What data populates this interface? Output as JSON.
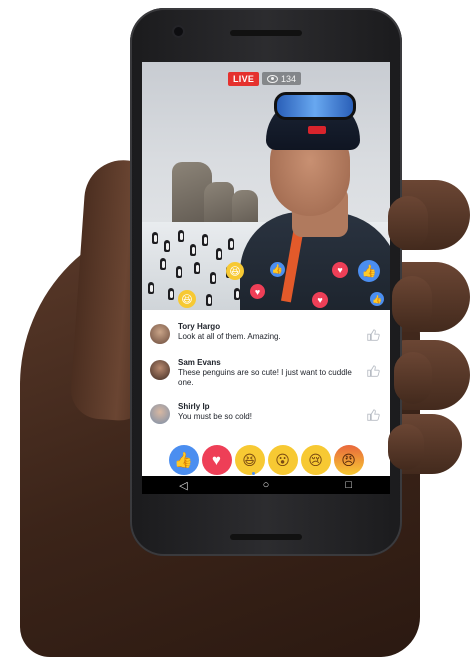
{
  "live": {
    "badge_label": "LIVE",
    "viewer_count": "134"
  },
  "comments": [
    {
      "name": "Tory Hargo",
      "text": "Look at all of them. Amazing."
    },
    {
      "name": "Sam Evans",
      "text": "These penguins are so cute! I just want to cuddle one."
    },
    {
      "name": "Shirly Ip",
      "text": "You must be so cold!"
    }
  ],
  "reactions": [
    {
      "id": "like",
      "icon": "thumbs-up-icon",
      "glyph": "👍"
    },
    {
      "id": "love",
      "icon": "heart-icon",
      "glyph": "♥"
    },
    {
      "id": "haha",
      "icon": "laughing-face-icon",
      "glyph": "😆"
    },
    {
      "id": "wow",
      "icon": "surprised-face-icon",
      "glyph": "😮"
    },
    {
      "id": "sad",
      "icon": "sad-face-icon",
      "glyph": "😢"
    },
    {
      "id": "angry",
      "icon": "angry-face-icon",
      "glyph": "😠"
    }
  ],
  "nav": {
    "back_glyph": "◁",
    "home_glyph": "○",
    "recents_glyph": "□"
  },
  "colors": {
    "live_red": "#e5312e",
    "facebook_blue": "#4b8ef0",
    "love_red": "#ee3f57",
    "emoji_yellow": "#f7c933"
  }
}
